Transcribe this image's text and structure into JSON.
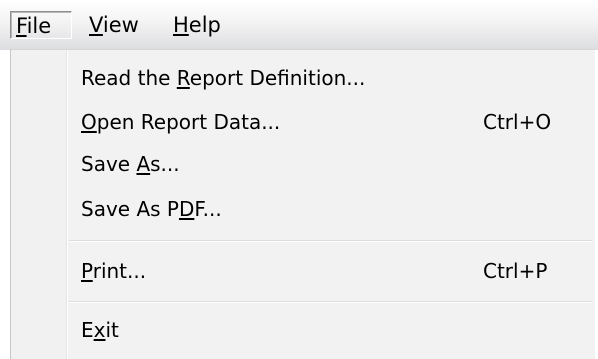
{
  "menubar": {
    "items": [
      {
        "pre": "",
        "accel": "F",
        "post": "ile"
      },
      {
        "pre": "",
        "accel": "V",
        "post": "iew"
      },
      {
        "pre": "",
        "accel": "H",
        "post": "elp"
      }
    ]
  },
  "file_menu": {
    "items": [
      {
        "pre": "Read the ",
        "accel": "R",
        "post": "eport Definition...",
        "shortcut": ""
      },
      {
        "pre": "",
        "accel": "O",
        "post": "pen Report Data...",
        "shortcut": "Ctrl+O"
      },
      {
        "pre": "Save ",
        "accel": "A",
        "post": "s...",
        "shortcut": ""
      },
      {
        "pre": "Save As P",
        "accel": "D",
        "post": "F...",
        "shortcut": ""
      },
      {
        "pre": "",
        "accel": "P",
        "post": "rint...",
        "shortcut": "Ctrl+P"
      },
      {
        "pre": "E",
        "accel": "x",
        "post": "it",
        "shortcut": ""
      }
    ]
  }
}
